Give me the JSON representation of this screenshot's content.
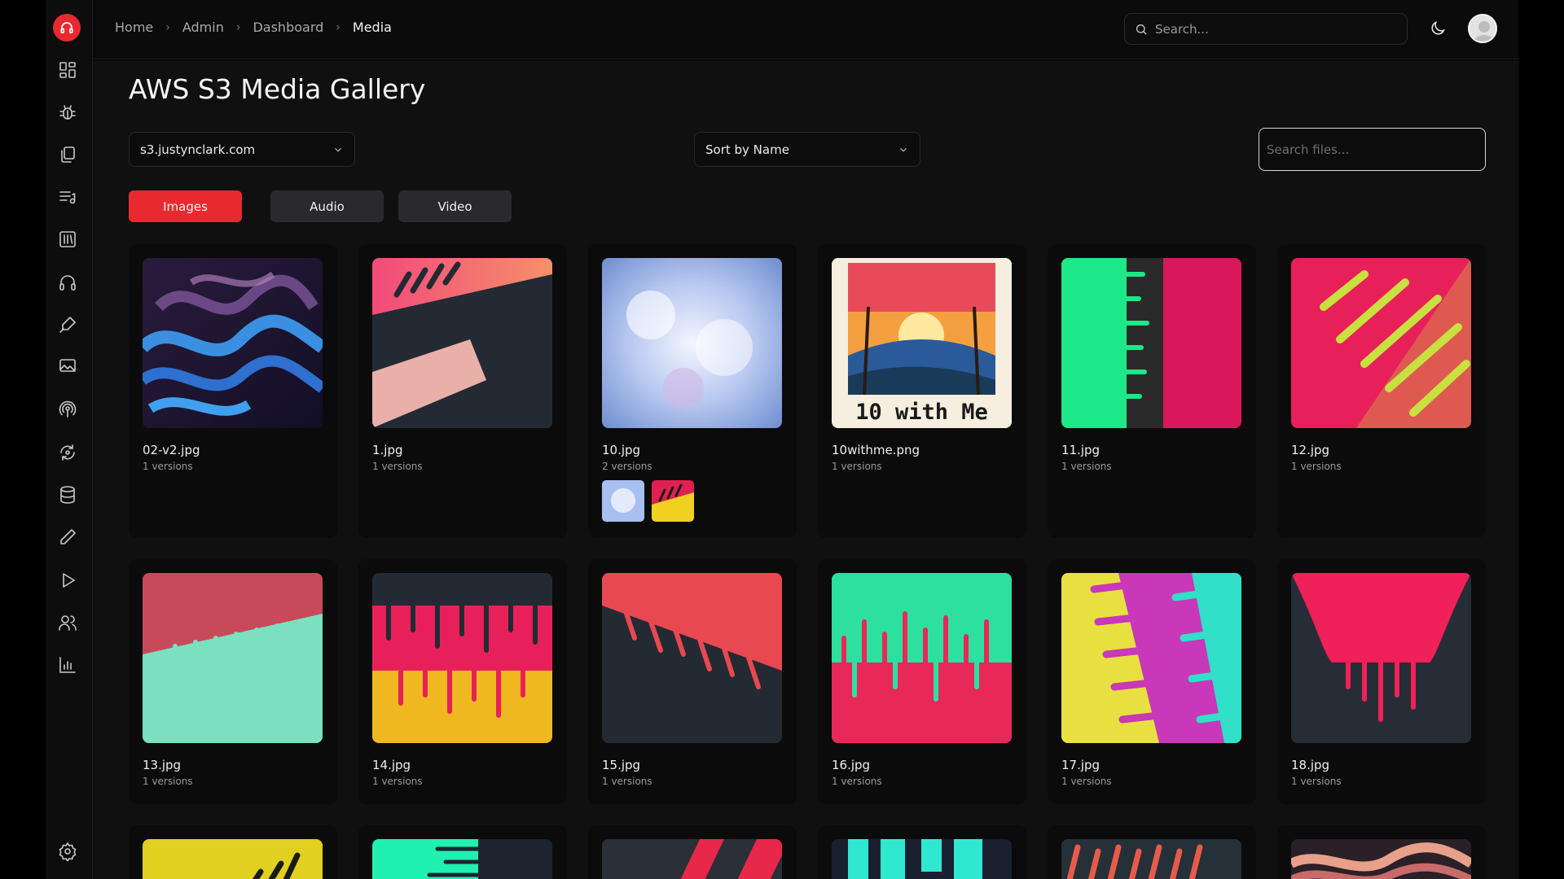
{
  "breadcrumb": [
    "Home",
    "Admin",
    "Dashboard",
    "Media"
  ],
  "top_search": {
    "placeholder": "Search..."
  },
  "page": {
    "title": "AWS S3 Media Gallery"
  },
  "bucket_select": {
    "value": "s3.justynclark.com"
  },
  "sort_select": {
    "value": "Sort by Name"
  },
  "file_search": {
    "placeholder": "Search files..."
  },
  "tabs": [
    {
      "label": "Images",
      "active": true
    },
    {
      "label": "Audio",
      "active": false
    },
    {
      "label": "Video",
      "active": false
    }
  ],
  "colors": {
    "accent": "#e8292f",
    "background": "#101011"
  },
  "sidebar_icons": [
    "dashboard-icon",
    "bug-icon",
    "files-icon",
    "playlist-icon",
    "library-icon",
    "headphones-icon",
    "pen-tool-icon",
    "image-icon",
    "podcast-icon",
    "sync-icon",
    "database-icon",
    "pencil-icon",
    "play-icon",
    "users-icon",
    "bar-chart-icon",
    "settings-icon"
  ],
  "files": [
    {
      "name": "02-v2.jpg",
      "versions": "1 versions"
    },
    {
      "name": "1.jpg",
      "versions": "1 versions"
    },
    {
      "name": "10.jpg",
      "versions": "2 versions"
    },
    {
      "name": "10withme.png",
      "versions": "1 versions",
      "image_text": "10 with Me"
    },
    {
      "name": "11.jpg",
      "versions": "1 versions"
    },
    {
      "name": "12.jpg",
      "versions": "1 versions"
    },
    {
      "name": "13.jpg",
      "versions": "1 versions"
    },
    {
      "name": "14.jpg",
      "versions": "1 versions"
    },
    {
      "name": "15.jpg",
      "versions": "1 versions"
    },
    {
      "name": "16.jpg",
      "versions": "1 versions"
    },
    {
      "name": "17.jpg",
      "versions": "1 versions"
    },
    {
      "name": "18.jpg",
      "versions": "1 versions"
    }
  ]
}
